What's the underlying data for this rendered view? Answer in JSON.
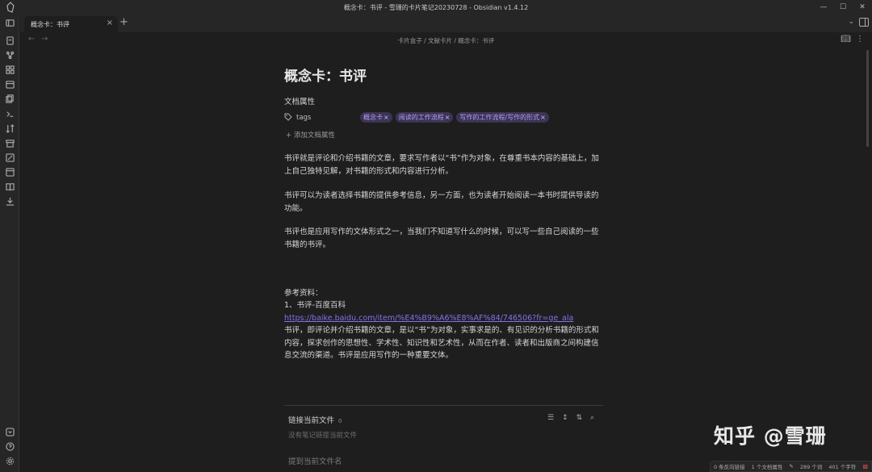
{
  "window": {
    "title": "概念卡：书评 - 雪珊的卡片笔记20230728 - Obsidian v1.4.12",
    "controls": [
      "—",
      "☐",
      "✕"
    ]
  },
  "tab": {
    "label": "概念卡：书评",
    "close": "×",
    "new": "+"
  },
  "breadcrumb": {
    "items": [
      "卡片盒子",
      "文献卡片",
      "概念卡：书评"
    ],
    "text": "卡片盒子 / 文献卡片 / 概念卡：书评"
  },
  "note": {
    "title": "概念卡：书评",
    "properties_heading": "文档属性",
    "property_key": "tags",
    "tags": [
      "概念卡",
      "阅读的工作流程",
      "写作的工作流程/写作的形式"
    ],
    "add_property": "添加文档属性",
    "paragraphs": [
      "书评就是评论和介绍书籍的文章，要求写作者以“书”作为对象，在尊重书本内容的基础上，加上自己独特见解，对书籍的形式和内容进行分析。",
      "书评可以为读者选择书籍的提供参考信息，另一方面，也为读者开始阅读一本书时提供导读的功能。",
      "书评也是应用写作的文体形式之一，当我们不知道写什么的时候，可以写一些自己阅读的一些书籍的书评。"
    ],
    "references_label": "参考资料：",
    "reference_item": "1、书评-百度百科",
    "reference_link": "https://baike.baidu.com/item/%E4%B9%A6%E8%AF%84/746506?fr=ge_ala",
    "reference_text": "书评，即评论并介绍书籍的文章，是以“书”为对象，实事求是的、有见识的分析书籍的形式和内容，探求创作的思想性、学术性、知识性和艺术性，从而在作者、读者和出版商之间构建信息交流的渠道。书评是应用写作的一种重要文体。"
  },
  "backlinks": {
    "title": "链接当前文件",
    "count": "0",
    "empty": "没有笔记链接当前文件",
    "mentions": "提到当前文件名"
  },
  "watermark": "知乎 @雪珊",
  "statusbar": {
    "backlinks": "0 条反向链接",
    "properties": "1 个文档属性",
    "words": "289 个词",
    "chars": "401 个字符"
  }
}
